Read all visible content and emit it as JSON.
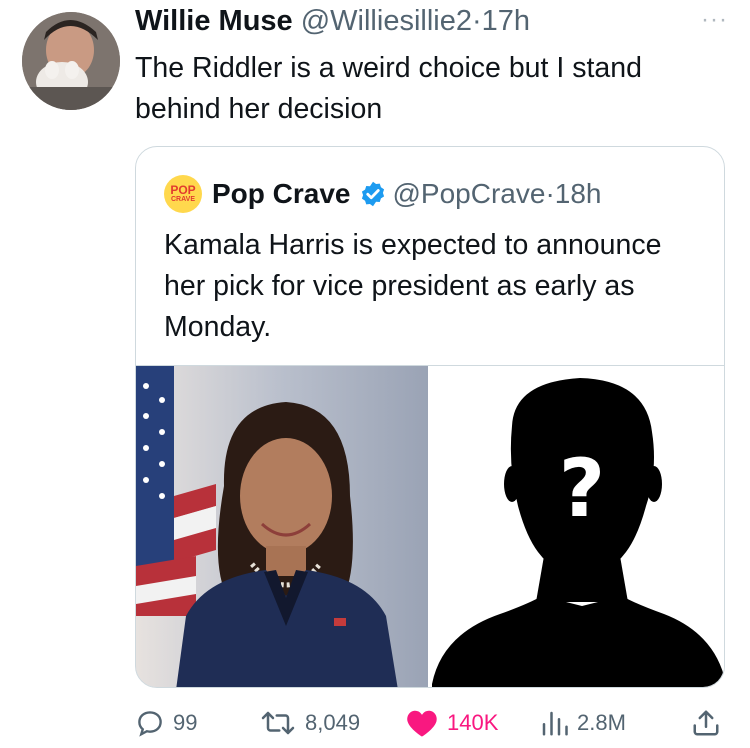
{
  "tweet": {
    "author_name": "Willie Muse",
    "handle": "@Williesillie2",
    "separator": "·",
    "time": "17h",
    "more": "···",
    "text": "The Riddler is a weird choice but I stand behind her decision"
  },
  "quote": {
    "logo_text_top": "POP",
    "logo_text_bottom": "CRAVE",
    "author_name": "Pop Crave",
    "handle": "@PopCrave",
    "separator": "·",
    "time": "18h",
    "text": "Kamala Harris is expected to announce her pick for vice president as early as Monday.",
    "silhouette_mark": "?"
  },
  "actions": {
    "replies": "99",
    "reposts": "8,049",
    "likes": "140K",
    "views": "2.8M"
  },
  "colors": {
    "like_pink": "#f91880",
    "verified_blue": "#1d9bf0",
    "muted": "#536471"
  },
  "icons": [
    "reply-icon",
    "repost-icon",
    "heart-icon",
    "views-icon",
    "share-icon",
    "verified-badge-icon"
  ]
}
